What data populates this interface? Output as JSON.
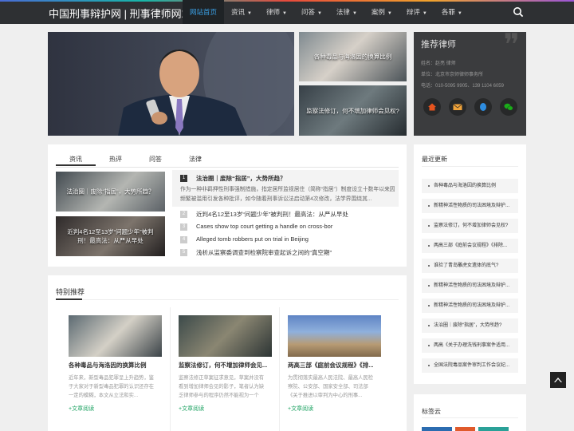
{
  "header": {
    "logo": "中国刑事辩护网 | 刑事律师网站",
    "nav": [
      {
        "label": "网站首页",
        "active": true,
        "dropdown": false
      },
      {
        "label": "资讯",
        "dropdown": true
      },
      {
        "label": "律师",
        "dropdown": true
      },
      {
        "label": "问答",
        "dropdown": true
      },
      {
        "label": "法律",
        "dropdown": true
      },
      {
        "label": "案例",
        "dropdown": true
      },
      {
        "label": "辩评",
        "dropdown": true
      },
      {
        "label": "各罪",
        "dropdown": true
      }
    ],
    "search_icon": "search-icon"
  },
  "hero": {
    "thumbs": [
      {
        "caption": "各种毒品与海洛因的换算比例"
      },
      {
        "caption": "监察法修订，何不增加律师会见权?"
      }
    ]
  },
  "lawyer": {
    "title": "推荐律师",
    "name": "姓名：赵亮 律师",
    "unit": "单位：北京市京师律师事务所",
    "phone": "电话：010-5095 9905、139 1104 6059",
    "icons": [
      {
        "name": "home-icon",
        "color": "#e7541e"
      },
      {
        "name": "mail-icon",
        "color": "#f0a33a"
      },
      {
        "name": "qq-icon",
        "color": "#2e8de0"
      },
      {
        "name": "wechat-icon",
        "color": "#1aad19"
      }
    ]
  },
  "news": {
    "tabs": [
      "资讯",
      "热评",
      "问答",
      "法律"
    ],
    "thumbs": [
      {
        "caption": "法治圈｜废除“指居”，大势所趋？"
      },
      {
        "caption": "近判4名12至13岁“问题少年”被判刑！最高法：从严从早处"
      }
    ],
    "featured": {
      "rank": "1",
      "title": "法治圈｜废除“指居”，大势所趋？",
      "desc": "作为一种非羁押性刑事强制措施，指定居所监视居住（简称“指居”）制度设立十数年以来因频繁被滥用引发各种批评，如今随着刑事诉讼法启动第4次修改，法学界围绕其..."
    },
    "items": [
      {
        "rank": "2",
        "title": "近判4名12至13岁“问题少年”被判刑！最高法：从严从早处"
      },
      {
        "rank": "3",
        "title": "Cases show top court getting a handle on cross-bor"
      },
      {
        "rank": "4",
        "title": "Alleged tomb robbers put on trial in Beijing"
      },
      {
        "rank": "5",
        "title": "浅析从监察委调查到检察院审查起诉之间的“真空期”"
      }
    ]
  },
  "special": {
    "heading": "特别推荐",
    "more_label": "+文章阅读",
    "cards": [
      {
        "title": "各种毒品与海洛因的换算比例",
        "desc": "近年来，新型毒品犯罪呈上升趋势，鉴于大家对于新型毒品犯罪的认识还存在一定的模糊，本文从立法和实..."
      },
      {
        "title": "监察法修订，何不增加律师会见...",
        "desc": "监察法修正草案征求意见，草案并没有看到增加律师会见的影子，笔者认为缺乏律师参与的程序仍然不能视为一个完..."
      },
      {
        "title": "两高三部《庭前会议规程》《排...",
        "desc": "为贯彻落实最高人民法院、最高人民检察院、公安部、国家安全部、司法部《关于推进以审判为中心的刑事..."
      }
    ]
  },
  "recent": {
    "heading": "最近更新",
    "items": [
      "各种毒品与海洛因的换算比例",
      "新精神活性物质的司法困境及辩护...",
      "监察法修订，何不增加律师会见权?",
      "两高三部《庭前会议规程》《排除...",
      "谁捡了青岛雕虎女遗体的底气?",
      "新精神活性物质的司法困境及辩护...",
      "新精神活性物质的司法困境及辩护...",
      "法治圈｜废除“指居”，大势所趋?",
      "两高《关于办理洗钱刑事案件适用...",
      "全国法院毒品案件审判工作会议纪..."
    ]
  },
  "tags": {
    "heading": "标签云",
    "colors": [
      "#2b6cb0",
      "#e05a2b",
      "#2aa198"
    ]
  },
  "totop_icon": "arrow-up-icon"
}
